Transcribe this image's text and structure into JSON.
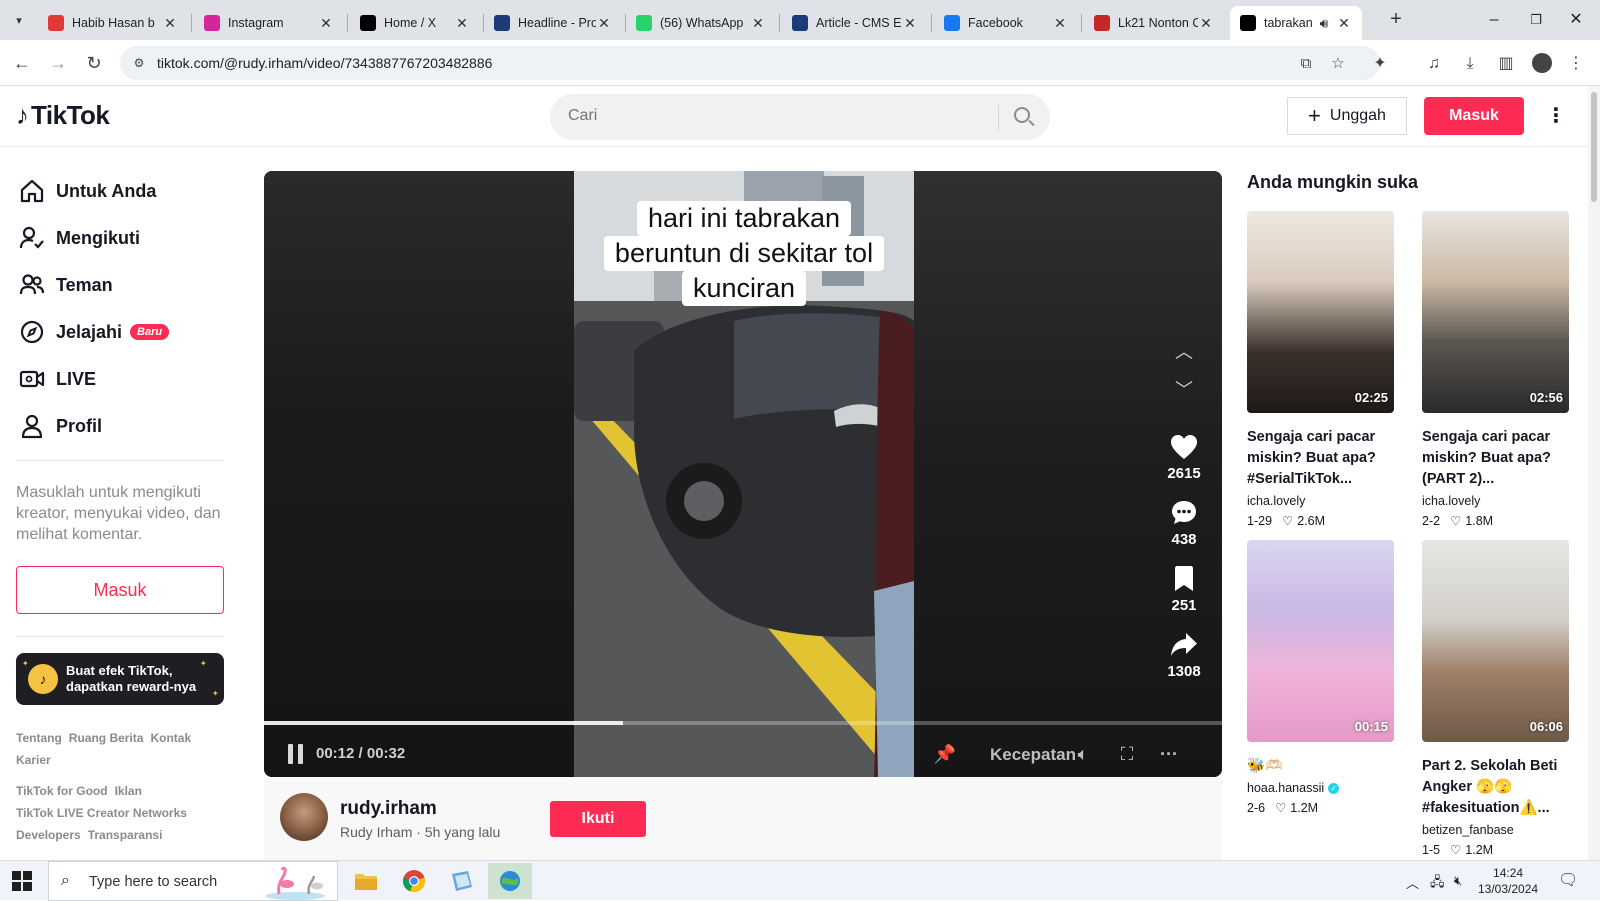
{
  "browser": {
    "tabs": [
      {
        "title": "Habib Hasan b",
        "favicon": "youtube-icon",
        "color": "#e53935",
        "active": false
      },
      {
        "title": "Instagram",
        "favicon": "instagram-icon",
        "color": "#d6249f",
        "active": false
      },
      {
        "title": "Home / X",
        "favicon": "x-icon",
        "color": "#000000",
        "active": false
      },
      {
        "title": "Headline - Pro",
        "favicon": "cms-icon",
        "color": "#1a3a7a",
        "active": false
      },
      {
        "title": "(56) WhatsApp",
        "favicon": "whatsapp-icon",
        "color": "#25d366",
        "active": false
      },
      {
        "title": "Article - CMS E",
        "favicon": "cms-icon",
        "color": "#1a3a7a",
        "active": false
      },
      {
        "title": "Facebook",
        "favicon": "facebook-icon",
        "color": "#1877f2",
        "active": false
      },
      {
        "title": "Lk21 Nonton C",
        "favicon": "lk21-icon",
        "color": "#c62828",
        "active": false
      },
      {
        "title": "tabrakan b",
        "favicon": "tiktok-icon",
        "color": "#000000",
        "active": true
      }
    ],
    "url": "tiktok.com/@rudy.irham/video/7343887767203482886"
  },
  "header": {
    "logo_text": "TikTok",
    "search_placeholder": "Cari",
    "upload_label": "Unggah",
    "login_label": "Masuk"
  },
  "sidebar": {
    "items": [
      {
        "label": "Untuk Anda",
        "icon": "home-icon"
      },
      {
        "label": "Mengikuti",
        "icon": "following-icon"
      },
      {
        "label": "Teman",
        "icon": "friends-icon"
      },
      {
        "label": "Jelajahi",
        "icon": "compass-icon",
        "badge": "Baru"
      },
      {
        "label": "LIVE",
        "icon": "live-icon"
      },
      {
        "label": "Profil",
        "icon": "profile-icon"
      }
    ],
    "login_prompt": "Masuklah untuk mengikuti kreator, menyukai video, dan melihat komentar.",
    "login_button": "Masuk",
    "promo_line1": "Buat efek TikTok,",
    "promo_line2": "dapatkan reward-nya",
    "footer_row1": [
      "Tentang",
      "Ruang Berita",
      "Kontak",
      "Karier"
    ],
    "footer_row2": [
      "TikTok for Good",
      "Iklan"
    ],
    "footer_row3": [
      "TikTok LIVE Creator Networks"
    ],
    "footer_row4": [
      "Developers",
      "Transparansi"
    ]
  },
  "video": {
    "caption_lines": [
      "hari ini tabrakan",
      "beruntun di sekitar tol",
      "kunciran"
    ],
    "likes": "2615",
    "comments": "438",
    "saves": "251",
    "shares": "1308",
    "time": "00:12 / 00:32",
    "progress": 0.375,
    "speed_label": "Kecepatan"
  },
  "author": {
    "username": "rudy.irham",
    "subtitle": "Rudy Irham · 5h yang lalu",
    "follow_label": "Ikuti"
  },
  "recommendations": {
    "title": "Anda mungkin suka",
    "items": [
      {
        "title": "Sengaja cari pacar miskin? Buat apa? #SerialTikTok...",
        "author": "icha.lovely",
        "date": "1-29",
        "likes": "2.6M",
        "duration": "02:25",
        "verified": false
      },
      {
        "title": "Sengaja cari pacar miskin? Buat apa? (PART 2)...",
        "author": "icha.lovely",
        "date": "2-2",
        "likes": "1.8M",
        "duration": "02:56",
        "verified": false
      },
      {
        "title": "🐝🫶🏻",
        "author": "hoaa.hanassii",
        "date": "2-6",
        "likes": "1.2M",
        "duration": "00:15",
        "verified": true
      },
      {
        "title": "Part 2. Sekolah Beti Angker 🫣🫣 #fakesituation⚠️...",
        "author": "betizen_fanbase",
        "date": "1-5",
        "likes": "1.2M",
        "duration": "06:06",
        "verified": false
      }
    ]
  },
  "taskbar": {
    "search_placeholder": "Type here to search",
    "time": "14:24",
    "date": "13/03/2024"
  }
}
